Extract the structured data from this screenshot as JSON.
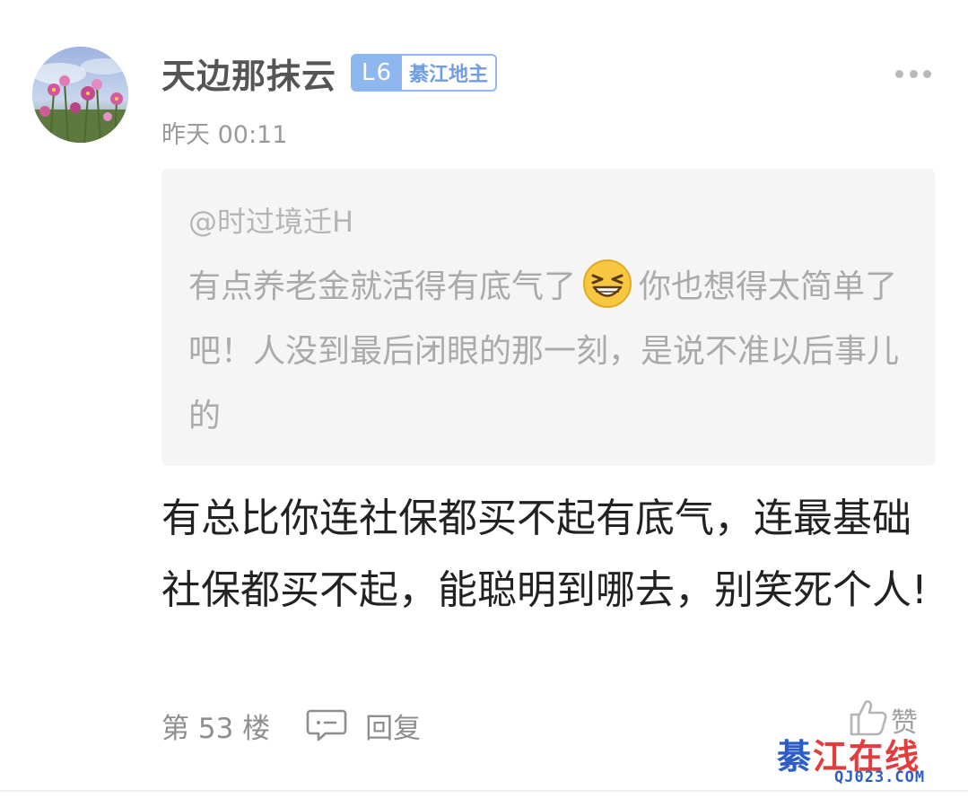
{
  "post": {
    "author": {
      "name": "天边那抹云",
      "level": "L6",
      "level_title": "綦江地主",
      "badge_color": "#8db7ee"
    },
    "timestamp": "昨天 00:11",
    "quote": {
      "user": "@时过境迁H",
      "text_before_emoji": "有点养老金就活得有底气了",
      "emoji": "grinning-squint-emoji",
      "text_after_emoji": "你也想得太简单了吧！人没到最后闭眼的那一刻，是说不准以后事儿的"
    },
    "content": "有总比你连社保都买不起有底气，连最基础社保都买不起，能聪明到哪去，别笑死个人!",
    "footer": {
      "floor": "第 53 楼",
      "reply_label": "回复",
      "like_label": "赞"
    },
    "watermark": {
      "main_blue": "綦",
      "main_red": "江在线",
      "sub": "QJ023.COM"
    },
    "icons": {
      "more": "more-dots-icon",
      "reply": "comment-bubble-icon",
      "like": "thumbs-up-icon"
    }
  }
}
